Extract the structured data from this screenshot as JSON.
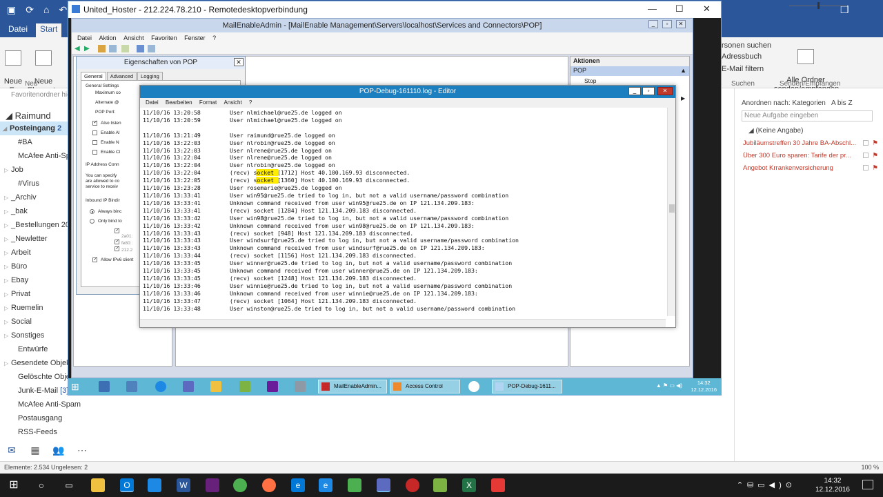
{
  "outlook": {
    "tabs": [
      "Datei",
      "Start"
    ],
    "ribbon": {
      "new_email": "Neue\nE-Mail",
      "new_items": "Neue\nElemente",
      "group_new": "Neu",
      "search_people": "rsonen suchen",
      "address_book": "Adressbuch",
      "filter_email": "E-Mail filtern",
      "group_search": "Suchen",
      "send_receive_all": "Alle Ordner\nsenden/empfangen",
      "group_send_receive": "Senden/Empfangen"
    },
    "nav": {
      "favorites": "Favoritenordner hier",
      "account": "Raimund",
      "folders": [
        {
          "label": "Posteingang",
          "count": "2",
          "selected": true,
          "exp": "◢"
        },
        {
          "label": "#BA",
          "count": "",
          "exp": ""
        },
        {
          "label": "McAfee Anti-Spam",
          "count": "",
          "exp": ""
        },
        {
          "label": "Job",
          "count": "",
          "exp": "▷"
        },
        {
          "label": "#Virus",
          "count": "",
          "exp": ""
        },
        {
          "label": "_Archiv",
          "count": "",
          "exp": "▷"
        },
        {
          "label": "_bak",
          "count": "",
          "exp": "▷"
        },
        {
          "label": "_Bestellungen 20",
          "count": "",
          "exp": "▷"
        },
        {
          "label": "_Newletter",
          "count": "",
          "exp": "▷"
        },
        {
          "label": "Arbeit",
          "count": "",
          "exp": "▷"
        },
        {
          "label": "Büro",
          "count": "",
          "exp": "▷"
        },
        {
          "label": "Ebay",
          "count": "",
          "exp": "▷"
        },
        {
          "label": "Privat",
          "count": "",
          "exp": "▷"
        },
        {
          "label": "Ruemelin",
          "count": "",
          "exp": "▷"
        },
        {
          "label": "Social",
          "count": "",
          "exp": "▷"
        },
        {
          "label": "Sonstiges",
          "count": "",
          "exp": "▷"
        },
        {
          "label": "Entwürfe",
          "count": "",
          "exp": ""
        },
        {
          "label": "Gesendete Objekte",
          "count": "",
          "exp": "▷"
        },
        {
          "label": "Gelöschte Objekte",
          "count": "",
          "exp": ""
        },
        {
          "label": "Junk-E-Mail",
          "count": "[3]",
          "exp": ""
        },
        {
          "label": "McAfee Anti-Spam",
          "count": "",
          "exp": ""
        },
        {
          "label": "Postausgang",
          "count": "",
          "exp": ""
        },
        {
          "label": "RSS-Feeds",
          "count": "",
          "exp": ""
        }
      ]
    },
    "tasks": {
      "arrange": "Anordnen nach: Kategorien",
      "sort": "A bis Z",
      "new_task_placeholder": "Neue Aufgabe eingeben",
      "group": "(Keine Angabe)",
      "items": [
        "Jubiläumstreffen 30 Jahre BA-Abschl...",
        "Über 300 Euro sparen: Tarife der pr...",
        "Angebot Krrankenversicherung"
      ]
    },
    "status": {
      "left": "Elemente: 2.534   Ungelesen: 2",
      "zoom": "100 %"
    }
  },
  "rdp": {
    "title": "United_Hoster - 212.224.78.210 - Remotedesktopverbindung"
  },
  "mmc": {
    "title": "MailEnableAdmin - [MailEnable Management\\Servers\\localhost\\Services and Connectors\\POP]",
    "menu": [
      "Datei",
      "Aktion",
      "Ansicht",
      "Favoriten",
      "Fenster",
      "?"
    ],
    "actions": {
      "header": "Aktionen",
      "section": "POP",
      "stop": "Stop"
    }
  },
  "props": {
    "title": "Eigenschaften von POP",
    "tabs": [
      "General",
      "Advanced",
      "Logging"
    ],
    "labels": {
      "general_settings": "General Settings",
      "max_conn": "Maximum co",
      "alternate": "Alternate @",
      "pop_port": "POP Port:",
      "also_listen": "Also listen",
      "enable_a": "Enable Al",
      "enable_n": "Enable N",
      "enable_c": "Enable Cl",
      "ip_address": "IP Address Conn",
      "you_can": "You can specify",
      "are_allowed": "are allowed to co",
      "service_to": "service to receiv",
      "inbound": "Inbound IP Bindir",
      "always_bind": "Always binc",
      "only_bind": "Only bind to",
      "ip_2a01": "2a01:",
      "ip_fe80": "fe80::",
      "ip_212": "212.2",
      "allow_ipv6": "Allow IPv6 client"
    }
  },
  "notepad": {
    "title": "POP-Debug-161110.log - Editor",
    "menu": [
      "Datei",
      "Bearbeiten",
      "Format",
      "Ansicht",
      "?"
    ],
    "lines": [
      {
        "ts": "11/10/16 13:20:58",
        "msg": "User nlmichael@rue25.de logged on"
      },
      {
        "ts": "11/10/16 13:20:59",
        "msg": "User nlmichael@rue25.de logged on"
      },
      {
        "ts": "",
        "msg": ""
      },
      {
        "ts": "11/10/16 13:21:49",
        "msg": "User raimund@rue25.de logged on"
      },
      {
        "ts": "11/10/16 13:22:03",
        "msg": "User nlrobin@rue25.de logged on"
      },
      {
        "ts": "11/10/16 13:22:03",
        "msg": "User nlrene@rue25.de logged on"
      },
      {
        "ts": "11/10/16 13:22:04",
        "msg": "User nlrene@rue25.de logged on"
      },
      {
        "ts": "11/10/16 13:22:04",
        "msg": "User nlrobin@rue25.de logged on"
      },
      {
        "ts": "11/10/16 13:22:04",
        "msg": "(recv) socket [1712] Host 40.100.169.93 disconnected.",
        "hl": true
      },
      {
        "ts": "11/10/16 13:22:05",
        "msg": "(recv) socket [1360] Host 40.100.169.93 disconnected.",
        "hl": true
      },
      {
        "ts": "11/10/16 13:23:28",
        "msg": "User rosemarie@rue25.de logged on"
      },
      {
        "ts": "11/10/16 13:33:41",
        "msg": "User win95@rue25.de tried to log in, but not a valid username/password combination"
      },
      {
        "ts": "11/10/16 13:33:41",
        "msg": "Unknown command received from user win95@rue25.de on IP 121.134.209.183:"
      },
      {
        "ts": "11/10/16 13:33:41",
        "msg": "(recv) socket [1284] Host 121.134.209.183 disconnected."
      },
      {
        "ts": "11/10/16 13:33:42",
        "msg": "User win98@rue25.de tried to log in, but not a valid username/password combination"
      },
      {
        "ts": "11/10/16 13:33:42",
        "msg": "Unknown command received from user win98@rue25.de on IP 121.134.209.183:"
      },
      {
        "ts": "11/10/16 13:33:43",
        "msg": "(recv) socket [948] Host 121.134.209.183 disconnected."
      },
      {
        "ts": "11/10/16 13:33:43",
        "msg": "User windsurf@rue25.de tried to log in, but not a valid username/password combination"
      },
      {
        "ts": "11/10/16 13:33:43",
        "msg": "Unknown command received from user windsurf@rue25.de on IP 121.134.209.183:"
      },
      {
        "ts": "11/10/16 13:33:44",
        "msg": "(recv) socket [1156] Host 121.134.209.183 disconnected."
      },
      {
        "ts": "11/10/16 13:33:45",
        "msg": "User winner@rue25.de tried to log in, but not a valid username/password combination"
      },
      {
        "ts": "11/10/16 13:33:45",
        "msg": "Unknown command received from user winner@rue25.de on IP 121.134.209.183:"
      },
      {
        "ts": "11/10/16 13:33:45",
        "msg": "(recv) socket [1248] Host 121.134.209.183 disconnected."
      },
      {
        "ts": "11/10/16 13:33:46",
        "msg": "User winnie@rue25.de tried to log in, but not a valid username/password combination"
      },
      {
        "ts": "11/10/16 13:33:46",
        "msg": "Unknown command received from user winnie@rue25.de on IP 121.134.209.183:"
      },
      {
        "ts": "11/10/16 13:33:47",
        "msg": "(recv) socket [1064] Host 121.134.209.183 disconnected."
      },
      {
        "ts": "11/10/16 13:33:48",
        "msg": "User winston@rue25.de tried to log in, but not a valid username/password combination"
      }
    ]
  },
  "remote_taskbar": {
    "buttons": [
      "MailEnableAdmin...",
      "Access Control",
      "POP-Debug-1611..."
    ],
    "time": "14:32",
    "date": "12.12.2016"
  },
  "host_taskbar": {
    "time": "14:32",
    "date": "12.12.2016"
  },
  "colors": {
    "outlook_blue": "#2b579a",
    "notepad_title": "#1c7fbf",
    "remote_taskbar": "#5fb7d6",
    "highlight": "#ffec00"
  }
}
